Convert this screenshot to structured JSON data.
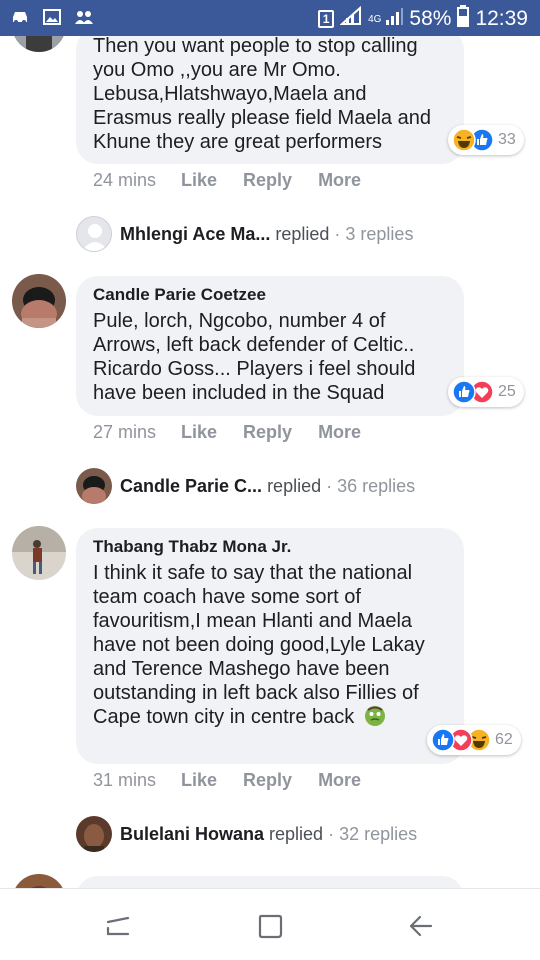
{
  "status_bar": {
    "sim_slot": "1",
    "network_type": "4G",
    "battery": "58%",
    "time": "12:39",
    "icons": [
      "car-icon",
      "image-icon",
      "people-icon",
      "sim-icon",
      "signal-icon",
      "battery-icon"
    ]
  },
  "comments": [
    {
      "text": "Then you want people to stop calling you Omo ,,you are Mr Omo. Lebusa,Hlatshwayo,Maela and Erasmus really please field Maela and Khune they are great performers",
      "reactions": [
        "haha",
        "like"
      ],
      "reaction_count": "33",
      "time": "24 mins",
      "like_label": "Like",
      "reply_label": "Reply",
      "more_label": "More",
      "replies": {
        "name": "Mhlengi Ace Ma...",
        "replied": "replied",
        "sep": "·",
        "count": "3 replies"
      }
    },
    {
      "name": "Candle Parie Coetzee",
      "text": "Pule, lorch, Ngcobo, number 4 of Arrows, left back defender of Celtic.. Ricardo Goss... Players i feel should have been included in the Squad",
      "reactions": [
        "like",
        "love"
      ],
      "reaction_count": "25",
      "time": "27 mins",
      "like_label": "Like",
      "reply_label": "Reply",
      "more_label": "More",
      "replies": {
        "name": "Candle Parie C...",
        "replied": "replied",
        "sep": "·",
        "count": "36 replies"
      }
    },
    {
      "name": "Thabang Thabz Mona Jr.",
      "text": "I think it safe to say that the national team coach have some sort of favouritism,I mean Hlanti and Maela have not been doing good,Lyle Lakay and Terence Mashego have been outstanding in left back also Fillies of Cape town city in centre back",
      "emoji": "zombie-emoji",
      "reactions": [
        "like",
        "love",
        "haha"
      ],
      "reaction_count": "62",
      "time": "31 mins",
      "like_label": "Like",
      "reply_label": "Reply",
      "more_label": "More",
      "replies": {
        "name": "Bulelani Howana",
        "replied": "replied",
        "sep": "·",
        "count": "32 replies"
      }
    }
  ],
  "nav": {
    "icons": [
      "recent-apps-icon",
      "home-icon",
      "back-icon"
    ]
  },
  "colors": {
    "status_bar": "#3b5998",
    "bubble": "#f0f2f5",
    "meta_text": "#90949c",
    "like_blue": "#1877f2",
    "love_red": "#f33e58",
    "haha_yellow": "#f7b125"
  }
}
